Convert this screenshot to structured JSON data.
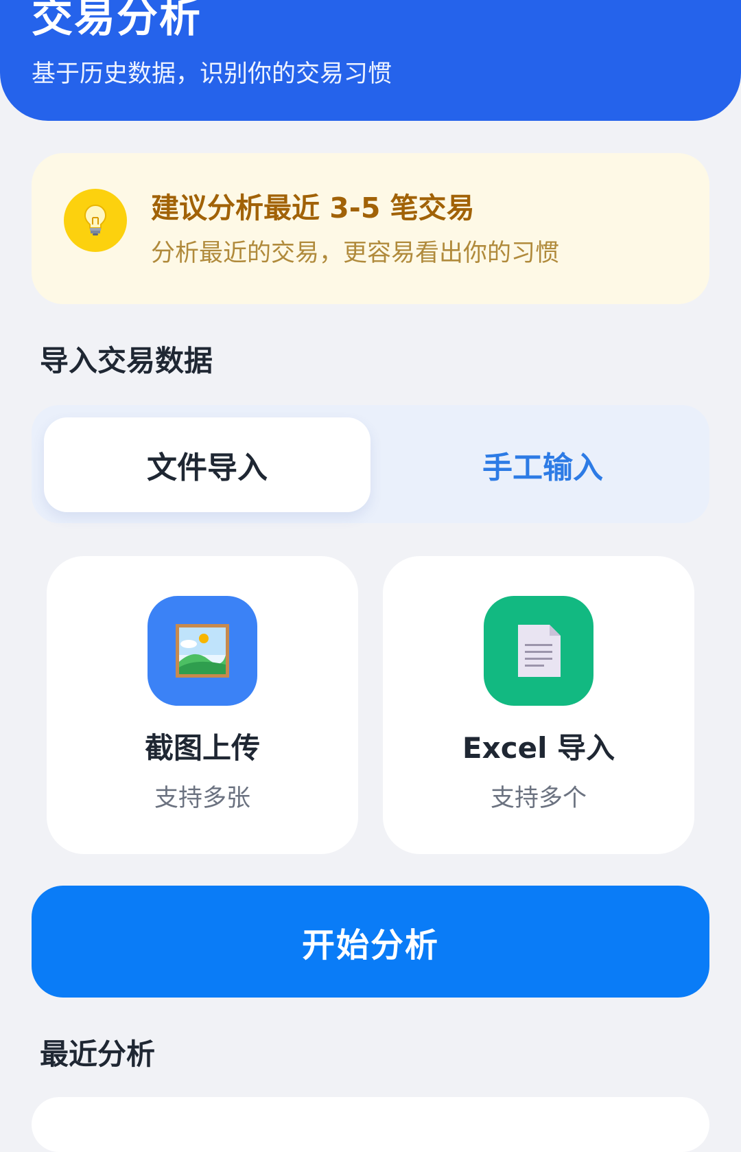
{
  "header": {
    "title": "交易分析",
    "subtitle": "基于历史数据，识别你的交易习惯"
  },
  "tip": {
    "icon": "lightbulb-icon",
    "title": "建议分析最近 3-5 笔交易",
    "description": "分析最近的交易，更容易看出你的习惯"
  },
  "import_section": {
    "title": "导入交易数据",
    "tabs": [
      {
        "label": "文件导入",
        "selected": true
      },
      {
        "label": "手工输入",
        "selected": false
      }
    ],
    "options": [
      {
        "icon": "picture-icon",
        "title": "截图上传",
        "subtitle": "支持多张"
      },
      {
        "icon": "document-icon",
        "title": "Excel 导入",
        "subtitle": "支持多个"
      }
    ]
  },
  "actions": {
    "start_label": "开始分析"
  },
  "recent_section": {
    "title": "最近分析"
  },
  "colors": {
    "header_bg": "#2563eb",
    "primary_button": "#0a7cf7",
    "tip_bg": "#fef9e6",
    "tip_title": "#a16207",
    "tab_inactive_text": "#2d7be5",
    "screenshot_icon_bg": "#3b82f6",
    "excel_icon_bg": "#12b981"
  }
}
